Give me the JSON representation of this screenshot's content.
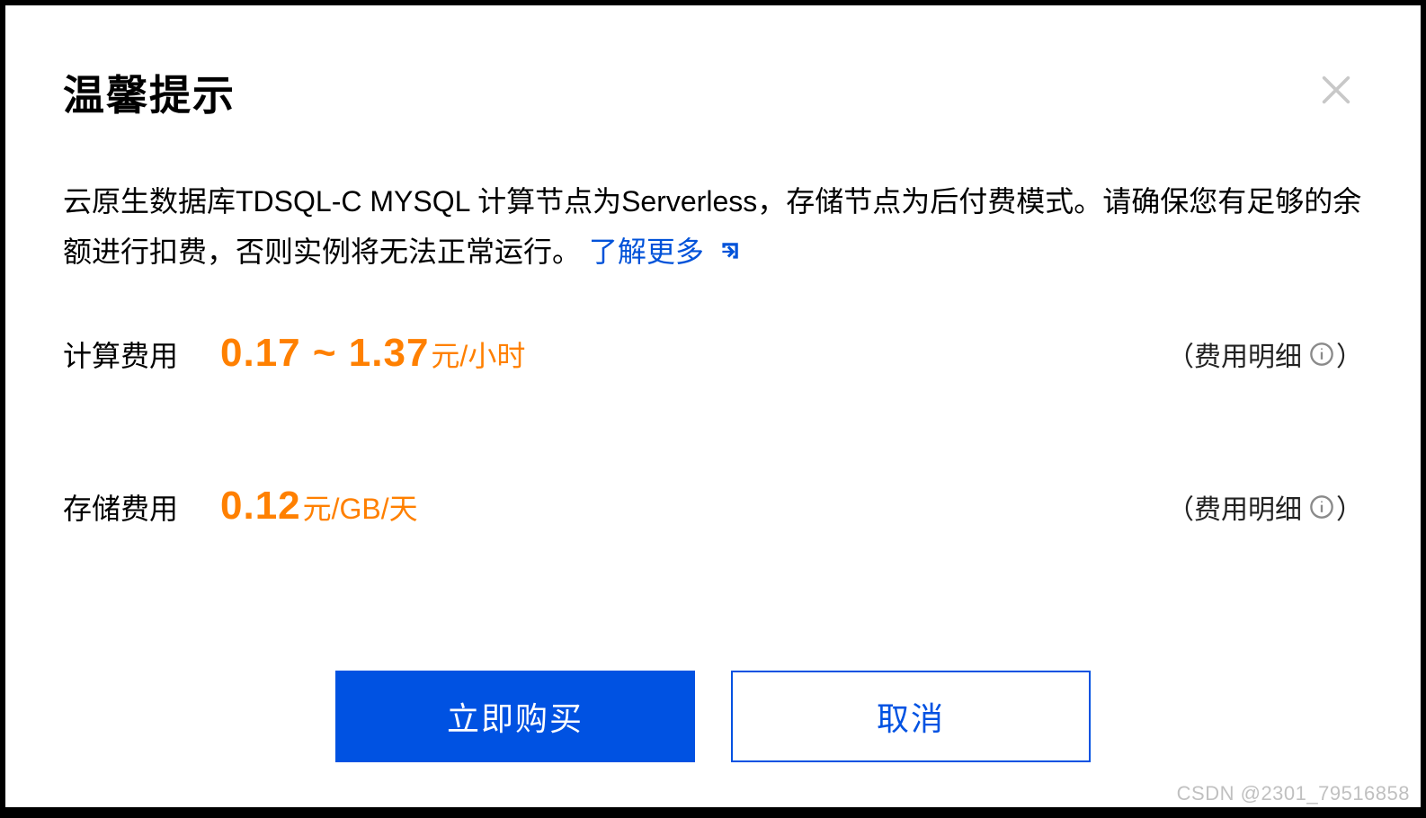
{
  "dialog": {
    "title": "温馨提示",
    "description_pre": "云原生数据库TDSQL-C MYSQL 计算节点为Serverless，存储节点为后付费模式。请确保您有足够的余额进行扣费，否则实例将无法正常运行。",
    "learn_more": "了解更多"
  },
  "costs": {
    "compute": {
      "label": "计算费用",
      "amount": "0.17 ~ 1.37",
      "unit": "元/小时",
      "detail_open": "（费用明细",
      "detail_close": "）"
    },
    "storage": {
      "label": "存储费用",
      "amount": "0.12",
      "unit": "元/GB/天",
      "detail_open": "（费用明细",
      "detail_close": "）"
    }
  },
  "footer": {
    "buy_label": "立即购买",
    "cancel_label": "取消"
  },
  "watermark": "CSDN @2301_79516858"
}
